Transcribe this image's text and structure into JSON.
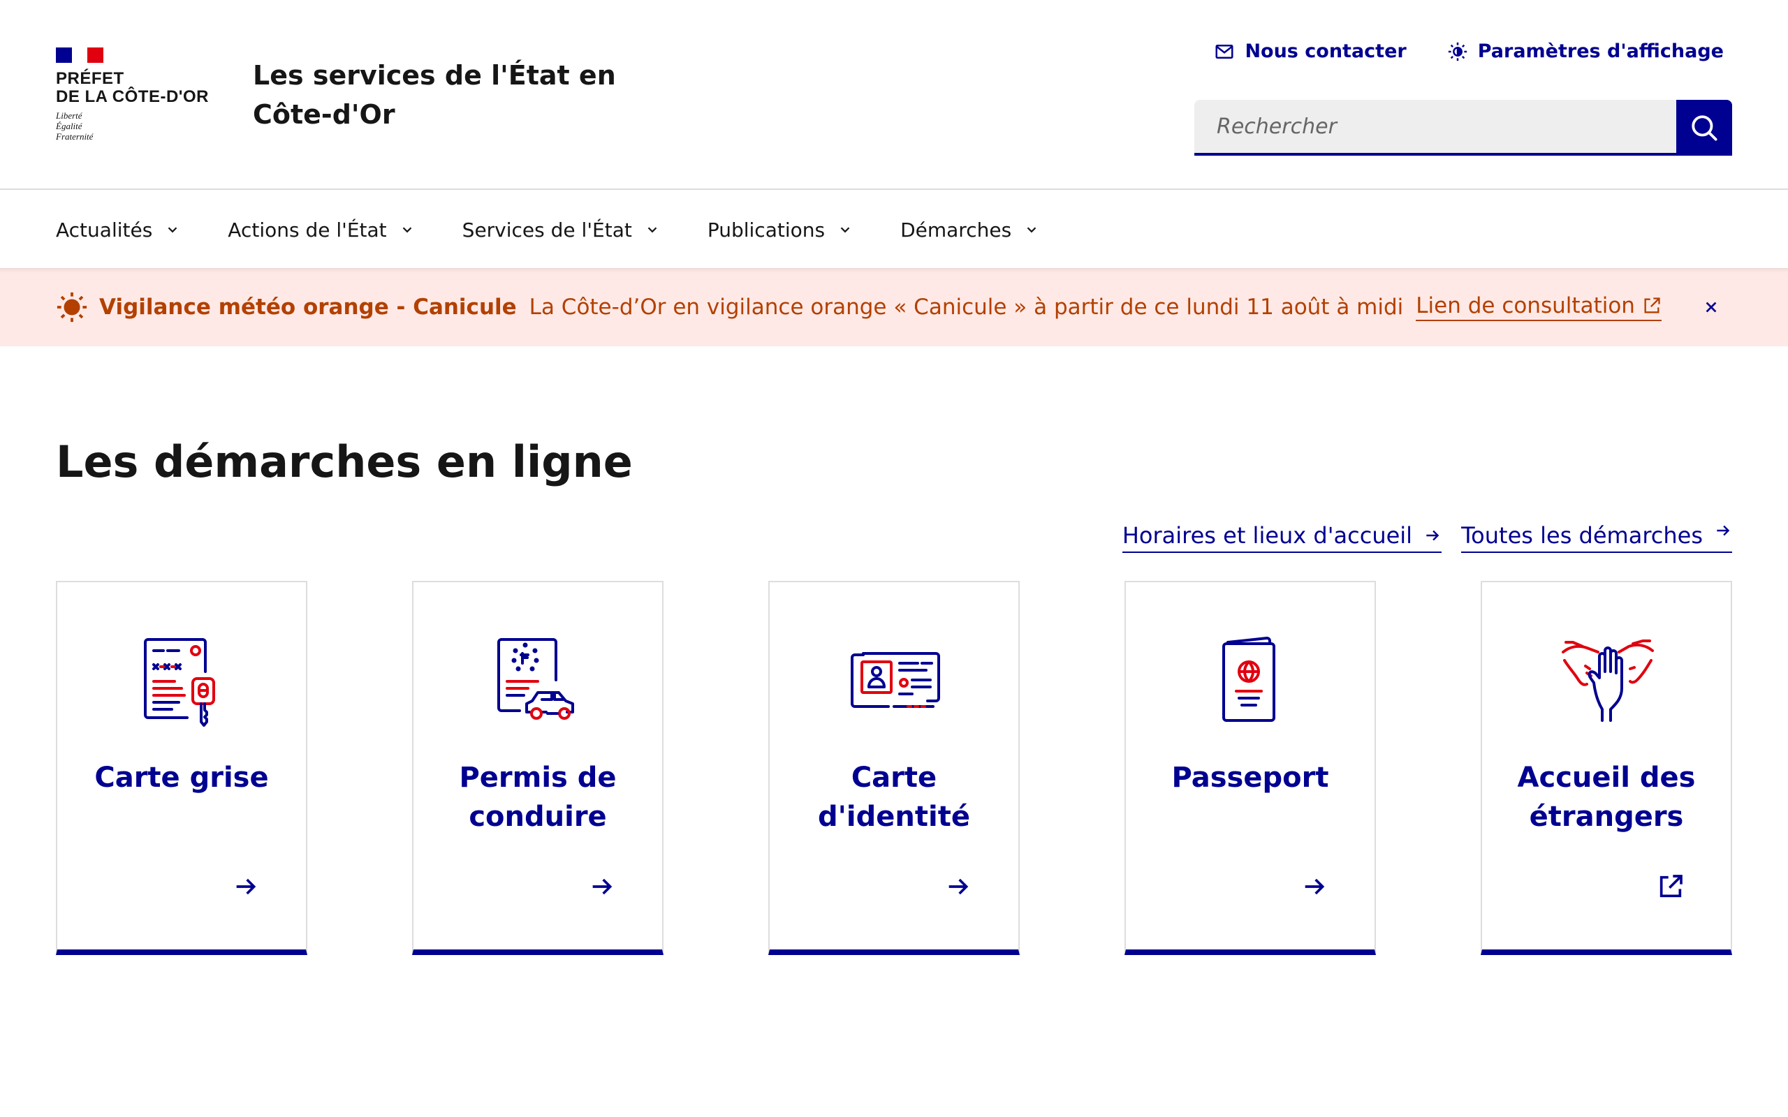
{
  "brand": {
    "logo_line1": "PRÉFET",
    "logo_line2": "DE LA CÔTE-D'OR",
    "motto_1": "Liberté",
    "motto_2": "Égalité",
    "motto_3": "Fraternité",
    "service_title": "Les services de l'État en Côte-d'Or",
    "flag_colors": [
      "#000091",
      "#ffffff",
      "#e1000f"
    ]
  },
  "tools": {
    "contact_label": "Nous contacter",
    "contact_icon": "mail-icon",
    "display_label": "Paramètres d'affichage",
    "display_icon": "sun-icon"
  },
  "search": {
    "placeholder": "Rechercher",
    "value": "",
    "button_icon": "search-icon"
  },
  "nav": {
    "items": [
      {
        "label": "Actualités"
      },
      {
        "label": "Actions de l'État"
      },
      {
        "label": "Services de l'État"
      },
      {
        "label": "Publications"
      },
      {
        "label": "Démarches"
      }
    ]
  },
  "alert": {
    "title": "Vigilance météo orange - Canicule",
    "text": "La Côte-d’Or en vigilance orange « Canicule » à partir de ce lundi 11 août à midi",
    "link_label": "Lien de consultation",
    "color": "#b34000",
    "background": "#fee9e6"
  },
  "main": {
    "title": "Les démarches en ligne",
    "links": [
      {
        "label": "Horaires et lieux d'accueil"
      },
      {
        "label": "Toutes les démarches"
      }
    ],
    "cards": [
      {
        "title": "Carte grise",
        "icon": "car-registration-icon",
        "arrow": "arrow-right-icon"
      },
      {
        "title": "Permis de conduire",
        "icon": "driving-license-icon",
        "arrow": "arrow-right-icon"
      },
      {
        "title": "Carte d'identité",
        "icon": "id-card-icon",
        "arrow": "arrow-right-icon"
      },
      {
        "title": "Passeport",
        "icon": "passport-icon",
        "arrow": "arrow-right-icon"
      },
      {
        "title": "Accueil des étrangers",
        "icon": "welcome-hands-icon",
        "arrow": "external-link-icon"
      }
    ]
  },
  "colors": {
    "primary": "#000091",
    "accent_red": "#e1000f"
  }
}
